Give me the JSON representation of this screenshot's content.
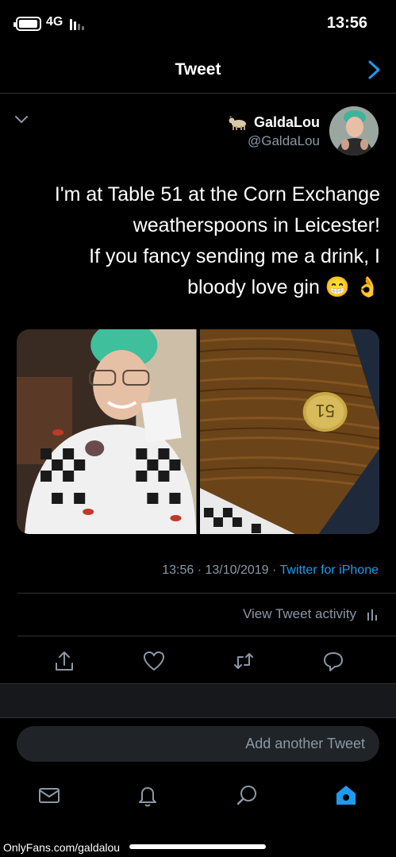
{
  "status_bar": {
    "time": "13:56",
    "network": "4G"
  },
  "nav": {
    "title": "Tweet"
  },
  "author": {
    "display_name": "GaldaLou",
    "handle": "@GaldaLou"
  },
  "tweet": {
    "lines": [
      "I'm at Table 51 at the Corn Exchange",
      "weatherspoons in Leicester!",
      "If you fancy sending me a drink, I",
      "bloody love gin 😁 👌"
    ],
    "timestamp": "13:56 · 13/10/2019 · ",
    "source": "Twitter for iPhone",
    "activity_label": "View Tweet activity"
  },
  "photos": [
    {
      "name": "selfie-photo",
      "description_color": "#3a2b22"
    },
    {
      "name": "table-number-photo",
      "description_color": "#6b4318",
      "label": "51"
    }
  ],
  "reply": {
    "placeholder": "Add another Tweet"
  },
  "tabs": [
    "home",
    "search",
    "notifications",
    "messages"
  ],
  "watermark": "OnlyFans.com/galdalou",
  "colors": {
    "accent": "#1d9bf0",
    "background": "#000000",
    "secondary_text": "#8b98a5"
  }
}
